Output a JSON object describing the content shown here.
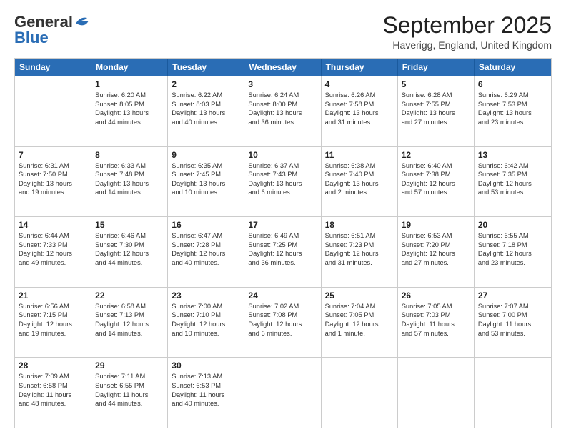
{
  "logo": {
    "line1": "General",
    "line2": "Blue"
  },
  "title": "September 2025",
  "subtitle": "Haverigg, England, United Kingdom",
  "header_days": [
    "Sunday",
    "Monday",
    "Tuesday",
    "Wednesday",
    "Thursday",
    "Friday",
    "Saturday"
  ],
  "rows": [
    [
      {
        "day": "",
        "lines": []
      },
      {
        "day": "1",
        "lines": [
          "Sunrise: 6:20 AM",
          "Sunset: 8:05 PM",
          "Daylight: 13 hours",
          "and 44 minutes."
        ]
      },
      {
        "day": "2",
        "lines": [
          "Sunrise: 6:22 AM",
          "Sunset: 8:03 PM",
          "Daylight: 13 hours",
          "and 40 minutes."
        ]
      },
      {
        "day": "3",
        "lines": [
          "Sunrise: 6:24 AM",
          "Sunset: 8:00 PM",
          "Daylight: 13 hours",
          "and 36 minutes."
        ]
      },
      {
        "day": "4",
        "lines": [
          "Sunrise: 6:26 AM",
          "Sunset: 7:58 PM",
          "Daylight: 13 hours",
          "and 31 minutes."
        ]
      },
      {
        "day": "5",
        "lines": [
          "Sunrise: 6:28 AM",
          "Sunset: 7:55 PM",
          "Daylight: 13 hours",
          "and 27 minutes."
        ]
      },
      {
        "day": "6",
        "lines": [
          "Sunrise: 6:29 AM",
          "Sunset: 7:53 PM",
          "Daylight: 13 hours",
          "and 23 minutes."
        ]
      }
    ],
    [
      {
        "day": "7",
        "lines": [
          "Sunrise: 6:31 AM",
          "Sunset: 7:50 PM",
          "Daylight: 13 hours",
          "and 19 minutes."
        ]
      },
      {
        "day": "8",
        "lines": [
          "Sunrise: 6:33 AM",
          "Sunset: 7:48 PM",
          "Daylight: 13 hours",
          "and 14 minutes."
        ]
      },
      {
        "day": "9",
        "lines": [
          "Sunrise: 6:35 AM",
          "Sunset: 7:45 PM",
          "Daylight: 13 hours",
          "and 10 minutes."
        ]
      },
      {
        "day": "10",
        "lines": [
          "Sunrise: 6:37 AM",
          "Sunset: 7:43 PM",
          "Daylight: 13 hours",
          "and 6 minutes."
        ]
      },
      {
        "day": "11",
        "lines": [
          "Sunrise: 6:38 AM",
          "Sunset: 7:40 PM",
          "Daylight: 13 hours",
          "and 2 minutes."
        ]
      },
      {
        "day": "12",
        "lines": [
          "Sunrise: 6:40 AM",
          "Sunset: 7:38 PM",
          "Daylight: 12 hours",
          "and 57 minutes."
        ]
      },
      {
        "day": "13",
        "lines": [
          "Sunrise: 6:42 AM",
          "Sunset: 7:35 PM",
          "Daylight: 12 hours",
          "and 53 minutes."
        ]
      }
    ],
    [
      {
        "day": "14",
        "lines": [
          "Sunrise: 6:44 AM",
          "Sunset: 7:33 PM",
          "Daylight: 12 hours",
          "and 49 minutes."
        ]
      },
      {
        "day": "15",
        "lines": [
          "Sunrise: 6:46 AM",
          "Sunset: 7:30 PM",
          "Daylight: 12 hours",
          "and 44 minutes."
        ]
      },
      {
        "day": "16",
        "lines": [
          "Sunrise: 6:47 AM",
          "Sunset: 7:28 PM",
          "Daylight: 12 hours",
          "and 40 minutes."
        ]
      },
      {
        "day": "17",
        "lines": [
          "Sunrise: 6:49 AM",
          "Sunset: 7:25 PM",
          "Daylight: 12 hours",
          "and 36 minutes."
        ]
      },
      {
        "day": "18",
        "lines": [
          "Sunrise: 6:51 AM",
          "Sunset: 7:23 PM",
          "Daylight: 12 hours",
          "and 31 minutes."
        ]
      },
      {
        "day": "19",
        "lines": [
          "Sunrise: 6:53 AM",
          "Sunset: 7:20 PM",
          "Daylight: 12 hours",
          "and 27 minutes."
        ]
      },
      {
        "day": "20",
        "lines": [
          "Sunrise: 6:55 AM",
          "Sunset: 7:18 PM",
          "Daylight: 12 hours",
          "and 23 minutes."
        ]
      }
    ],
    [
      {
        "day": "21",
        "lines": [
          "Sunrise: 6:56 AM",
          "Sunset: 7:15 PM",
          "Daylight: 12 hours",
          "and 19 minutes."
        ]
      },
      {
        "day": "22",
        "lines": [
          "Sunrise: 6:58 AM",
          "Sunset: 7:13 PM",
          "Daylight: 12 hours",
          "and 14 minutes."
        ]
      },
      {
        "day": "23",
        "lines": [
          "Sunrise: 7:00 AM",
          "Sunset: 7:10 PM",
          "Daylight: 12 hours",
          "and 10 minutes."
        ]
      },
      {
        "day": "24",
        "lines": [
          "Sunrise: 7:02 AM",
          "Sunset: 7:08 PM",
          "Daylight: 12 hours",
          "and 6 minutes."
        ]
      },
      {
        "day": "25",
        "lines": [
          "Sunrise: 7:04 AM",
          "Sunset: 7:05 PM",
          "Daylight: 12 hours",
          "and 1 minute."
        ]
      },
      {
        "day": "26",
        "lines": [
          "Sunrise: 7:05 AM",
          "Sunset: 7:03 PM",
          "Daylight: 11 hours",
          "and 57 minutes."
        ]
      },
      {
        "day": "27",
        "lines": [
          "Sunrise: 7:07 AM",
          "Sunset: 7:00 PM",
          "Daylight: 11 hours",
          "and 53 minutes."
        ]
      }
    ],
    [
      {
        "day": "28",
        "lines": [
          "Sunrise: 7:09 AM",
          "Sunset: 6:58 PM",
          "Daylight: 11 hours",
          "and 48 minutes."
        ]
      },
      {
        "day": "29",
        "lines": [
          "Sunrise: 7:11 AM",
          "Sunset: 6:55 PM",
          "Daylight: 11 hours",
          "and 44 minutes."
        ]
      },
      {
        "day": "30",
        "lines": [
          "Sunrise: 7:13 AM",
          "Sunset: 6:53 PM",
          "Daylight: 11 hours",
          "and 40 minutes."
        ]
      },
      {
        "day": "",
        "lines": []
      },
      {
        "day": "",
        "lines": []
      },
      {
        "day": "",
        "lines": []
      },
      {
        "day": "",
        "lines": []
      }
    ]
  ]
}
